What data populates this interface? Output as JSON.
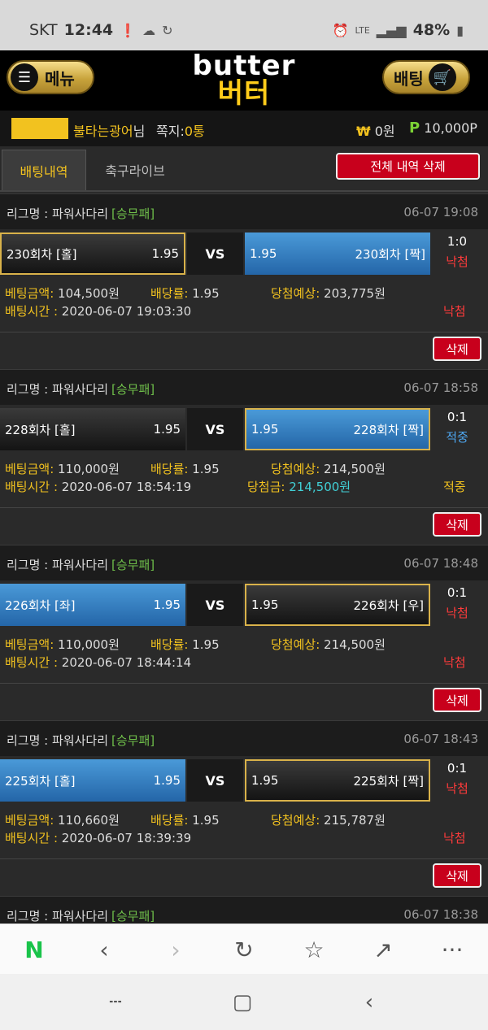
{
  "status": {
    "carrier": "SKT",
    "time": "12:44",
    "net": "LTE",
    "battery": "48%"
  },
  "header": {
    "menu_label": "메뉴",
    "bet_label": "배팅",
    "logo_en": "butter",
    "logo_ko": "버터"
  },
  "user": {
    "name": "불타는광어",
    "suffix": "님",
    "msg_label": "쪽지:",
    "msg_count": "0통",
    "won_symbol": "₩",
    "money": "0원",
    "point_symbol": "P",
    "points": "10,000P"
  },
  "tabs": {
    "active": "배팅내역",
    "inactive": "축구라이브",
    "delete_all": "전체 내역 삭제"
  },
  "labels": {
    "league": "리그명 : ",
    "amount": "베팅금액:",
    "odds": "배당률:",
    "expected": "당첨예상:",
    "time": "배팅시간 : ",
    "win_amount": "당첨금:",
    "vs": "VS",
    "delete": "삭제"
  },
  "bets": [
    {
      "league": "파워사다리",
      "type": "[승무패]",
      "date": "06-07 19:08",
      "home": {
        "name": "230회차 [홀]",
        "odds": "1.95"
      },
      "away": {
        "name": "230회차 [짝]",
        "odds": "1.95"
      },
      "score": "1:0",
      "result": "낙첨",
      "amount": "104,500원",
      "odds": "1.95",
      "expected": "203,775원",
      "time": "2020-06-07 19:03:30",
      "win_amount": "",
      "final": "낙첨"
    },
    {
      "league": "파워사다리",
      "type": "[승무패]",
      "date": "06-07 18:58",
      "home": {
        "name": "228회차 [홀]",
        "odds": "1.95"
      },
      "away": {
        "name": "228회차 [짝]",
        "odds": "1.95"
      },
      "score": "0:1",
      "result": "적중",
      "amount": "110,000원",
      "odds": "1.95",
      "expected": "214,500원",
      "time": "2020-06-07 18:54:19",
      "win_amount": "214,500원",
      "final": "적중"
    },
    {
      "league": "파워사다리",
      "type": "[승무패]",
      "date": "06-07 18:48",
      "home": {
        "name": "226회차 [좌]",
        "odds": "1.95"
      },
      "away": {
        "name": "226회차 [우]",
        "odds": "1.95"
      },
      "score": "0:1",
      "result": "낙첨",
      "amount": "110,000원",
      "odds": "1.95",
      "expected": "214,500원",
      "time": "2020-06-07 18:44:14",
      "win_amount": "",
      "final": "낙첨"
    },
    {
      "league": "파워사다리",
      "type": "[승무패]",
      "date": "06-07 18:43",
      "home": {
        "name": "225회차 [홀]",
        "odds": "1.95"
      },
      "away": {
        "name": "225회차 [짝]",
        "odds": "1.95"
      },
      "score": "0:1",
      "result": "낙첨",
      "amount": "110,660원",
      "odds": "1.95",
      "expected": "215,787원",
      "time": "2020-06-07 18:39:39",
      "win_amount": "",
      "final": "낙첨"
    },
    {
      "league": "파워사다리",
      "type": "[승무패]",
      "date": "06-07 18:38"
    }
  ],
  "colors": {
    "accent": "#f2c21f",
    "lost": "#ff3b3b",
    "hit": "#4ea6ef",
    "selected": "#2f7bc4",
    "delete": "#c8001c"
  },
  "browser": {
    "icons": [
      "naver-icon",
      "back-icon",
      "forward-icon",
      "refresh-icon",
      "bookmark-icon",
      "share-icon",
      "more-icon"
    ]
  }
}
